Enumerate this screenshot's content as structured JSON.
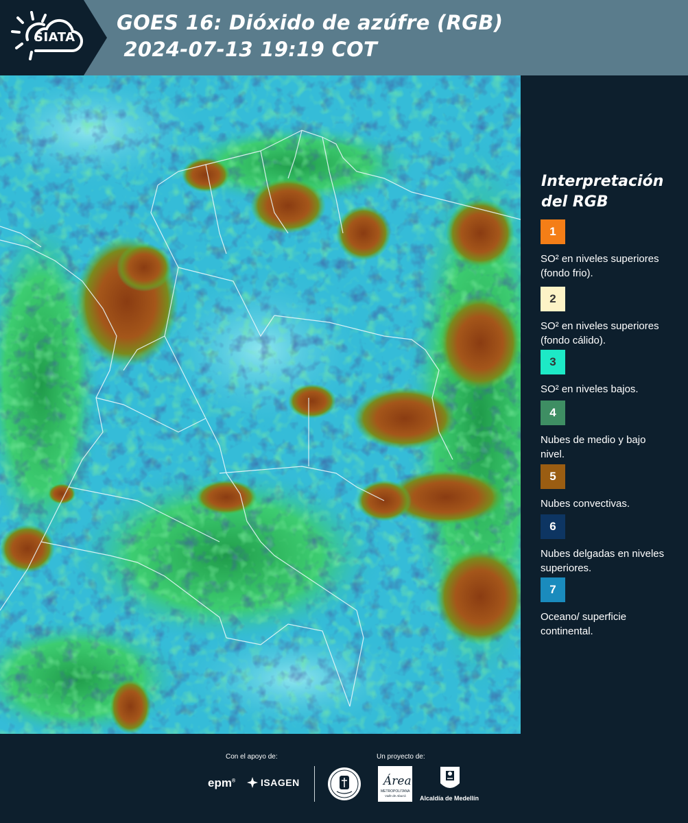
{
  "header": {
    "logo_text": "SIATA",
    "title_line1": "GOES 16: Dióxido de azúfre (RGB)",
    "title_line2": " 2024-07-13 19:19 COT",
    "background_color": "#5a7c8c"
  },
  "legend": {
    "title_line1": "Interpretación",
    "title_line2": "del RGB",
    "items": [
      {
        "number": "1",
        "color": "#f47e17",
        "description": "SO² en niveles superiores (fondo frio)."
      },
      {
        "number": "2",
        "color": "#fdf3c6",
        "description": "SO² en niveles superiores (fondo cálido)."
      },
      {
        "number": "3",
        "color": "#1de9c6",
        "description": "SO² en niveles bajos."
      },
      {
        "number": "4",
        "color": "#3e8e63",
        "description": "Nubes de medio y bajo nivel."
      },
      {
        "number": "5",
        "color": "#9a5d12",
        "description": "Nubes convectivas."
      },
      {
        "number": "6",
        "color": "#0d3562",
        "description": "Nubes delgadas en niveles superiores."
      },
      {
        "number": "7",
        "color": "#1a8bbd",
        "description": "Oceano/ superficie continental."
      }
    ]
  },
  "footer": {
    "support_label": "Con el apoyo de:",
    "project_label": "Un proyecto de:",
    "epm": "epm",
    "isagen": "ISAGEN",
    "area_name": "Área",
    "area_sub": "METROPOLITANA",
    "area_sub2": "Valle de Aburrá",
    "alcaldia": "Alcaldía de Medellín"
  }
}
